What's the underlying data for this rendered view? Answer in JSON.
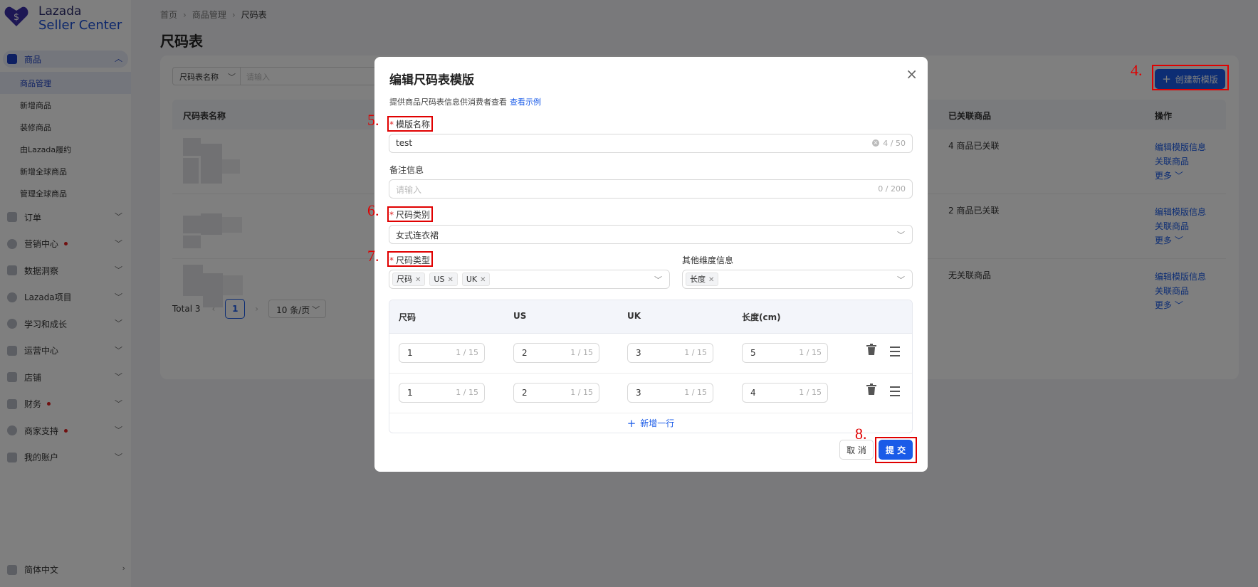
{
  "brand": {
    "line1": "Lazada",
    "line2": "Seller Center"
  },
  "sidebar": {
    "groups": [
      {
        "label": "商品"
      },
      {
        "label": "订单"
      },
      {
        "label": "营销中心"
      },
      {
        "label": "数据洞察"
      },
      {
        "label": "Lazada项目"
      },
      {
        "label": "学习和成长"
      },
      {
        "label": "运营中心"
      },
      {
        "label": "店铺"
      },
      {
        "label": "财务"
      },
      {
        "label": "商家支持"
      },
      {
        "label": "我的账户"
      }
    ],
    "sub_items": [
      "商品管理",
      "新增商品",
      "装修商品",
      "由Lazada履约",
      "新增全球商品",
      "管理全球商品"
    ],
    "language": "简体中文"
  },
  "breadcrumb": {
    "home": "首页",
    "section": "商品管理",
    "current": "尺码表"
  },
  "page_title": "尺码表",
  "filter": {
    "select_label": "尺码表名称",
    "placeholder": "请输入"
  },
  "create_button": "创建新模版",
  "table": {
    "headers": [
      "尺码表名称",
      "已关联商品",
      "操作"
    ],
    "rows": [
      {
        "linked": "4 商品已关联"
      },
      {
        "linked": "2 商品已关联"
      },
      {
        "linked": "无关联商品"
      }
    ],
    "actions": {
      "edit": "编辑模版信息",
      "link": "关联商品",
      "more": "更多"
    }
  },
  "pagination": {
    "total": "Total 3",
    "page": "1",
    "page_size": "10 条/页"
  },
  "modal": {
    "title": "编辑尺码表模版",
    "description": "提供商品尺码表信息供消费者查看",
    "example_link": "查看示例",
    "template_name": {
      "label": "模版名称",
      "value": "test",
      "count": "4 / 50"
    },
    "remark": {
      "label": "备注信息",
      "placeholder": "请输入",
      "count": "0 / 200"
    },
    "size_category": {
      "label": "尺码类别",
      "value": "女式连衣裙"
    },
    "size_type": {
      "label": "尺码类型",
      "tags": [
        "尺码",
        "US",
        "UK"
      ]
    },
    "other_dimension": {
      "label": "其他维度信息",
      "tags": [
        "长度"
      ]
    },
    "size_table": {
      "headers": [
        "尺码",
        "US",
        "UK",
        "长度(cm)"
      ],
      "rows": [
        [
          {
            "v": "1",
            "c": "1 / 15"
          },
          {
            "v": "2",
            "c": "1 / 15"
          },
          {
            "v": "3",
            "c": "1 / 15"
          },
          {
            "v": "5",
            "c": "1 / 15"
          }
        ],
        [
          {
            "v": "1",
            "c": "1 / 15"
          },
          {
            "v": "2",
            "c": "1 / 15"
          },
          {
            "v": "3",
            "c": "1 / 15"
          },
          {
            "v": "4",
            "c": "1 / 15"
          }
        ]
      ],
      "add_row": "新增一行"
    },
    "cancel": "取 消",
    "submit": "提 交"
  },
  "annotations": {
    "a4": "4.",
    "a5": "5.",
    "a6": "6.",
    "a7": "7.",
    "a8": "8."
  }
}
